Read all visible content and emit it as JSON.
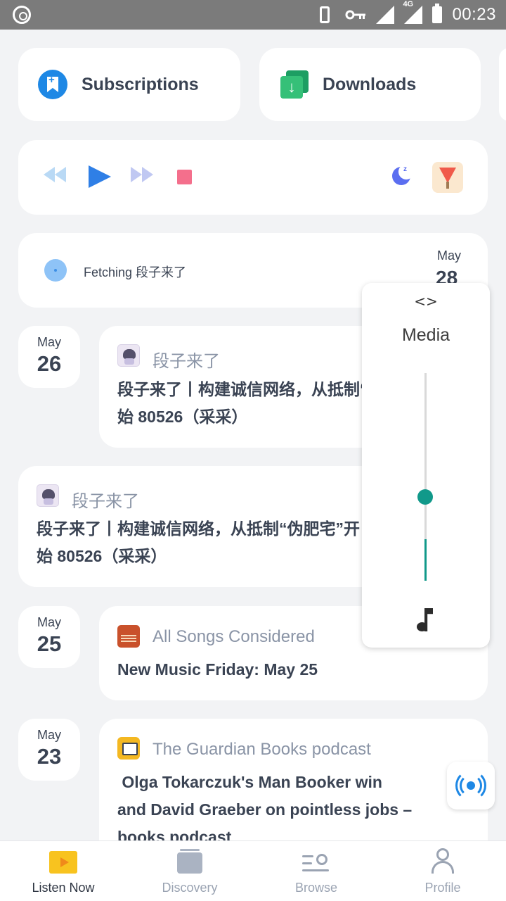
{
  "status_bar": {
    "time": "00:23",
    "network": "4G"
  },
  "shortcuts": {
    "subscriptions_label": "Subscriptions",
    "downloads_label": "Downloads"
  },
  "player": {
    "icons": [
      "rewind-icon",
      "play-icon",
      "fast-forward-icon",
      "stop-icon",
      "sleep-timer-icon",
      "watermelon-artwork-icon"
    ]
  },
  "fetching": {
    "text": "Fetching 段子来了",
    "month": "May",
    "day": "28"
  },
  "episodes": [
    {
      "month": "May",
      "day": "26",
      "source": "段子来了",
      "title_line1": "段子来了丨构建诚信网络，从抵制“伪肥宅”开",
      "title_line2": "始 80526（采采）"
    },
    {
      "source": "段子来了",
      "title_line1": "段子来了丨构建诚信网络，从抵制“伪肥宅”开",
      "title_line2": "始 80526（采采）"
    },
    {
      "month": "May",
      "day": "25",
      "source": "All Songs Considered",
      "title_line1": "New Music Friday: May 25"
    },
    {
      "month": "May",
      "day": "23",
      "source": "The Guardian Books podcast",
      "title_line1": " Olga Tokarczuk's Man Booker win",
      "title_line2": "and David Graeber on pointless jobs –",
      "title_line3": "books podcast"
    }
  ],
  "volume_panel": {
    "code_icon": "<>",
    "label": "Media",
    "level": 0.2,
    "icon": "music-note-icon"
  },
  "tabs": [
    {
      "label": "Listen Now",
      "active": true
    },
    {
      "label": "Discovery",
      "active": false
    },
    {
      "label": "Browse",
      "active": false
    },
    {
      "label": "Profile",
      "active": false
    }
  ],
  "colors": {
    "accent_blue": "#2f7fe6",
    "volume_teal": "#11998a",
    "stop_pink": "#f46f8c",
    "listen_yellow": "#f8c31f"
  }
}
